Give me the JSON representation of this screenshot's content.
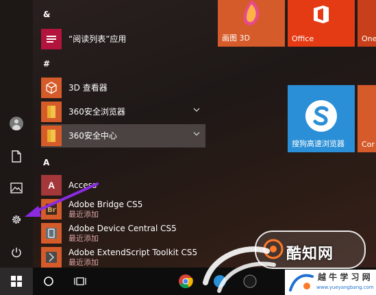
{
  "sections": {
    "ampersand": "&",
    "hash": "#",
    "a": "A"
  },
  "apps": {
    "reading_list": {
      "name": "“阅读列表”应用"
    },
    "viewer_3d": {
      "name": "3D 查看器"
    },
    "browser_360": {
      "name": "360安全浏览器"
    },
    "security_360": {
      "name": "360安全中心"
    },
    "access": {
      "name": "Access",
      "letter": "A"
    },
    "bridge": {
      "name": "Adobe Bridge CS5",
      "sub": "最近添加"
    },
    "device_central": {
      "name": "Adobe Device Central CS5",
      "sub": "最近添加"
    },
    "extendscript": {
      "name": "Adobe ExtendScript Toolkit CS5",
      "sub": "最近添加"
    }
  },
  "tiles": {
    "paint3d": {
      "label": "画图 3D"
    },
    "office": {
      "label": "Office"
    },
    "onenote": {
      "label": "One"
    },
    "sogou": {
      "label": "搜狗高速浏览器"
    },
    "cor": {
      "label": "Cor"
    }
  },
  "watermark": {
    "main": "酷知网",
    "bar_text": "越 牛 学 习 网",
    "url": "www.yueyangbang.com"
  },
  "colors": {
    "tile_orange": "#d65b2a",
    "tile_blue": "#2a8fd6",
    "office_red": "#e53b14",
    "arrow_purple": "#8a2be2"
  }
}
